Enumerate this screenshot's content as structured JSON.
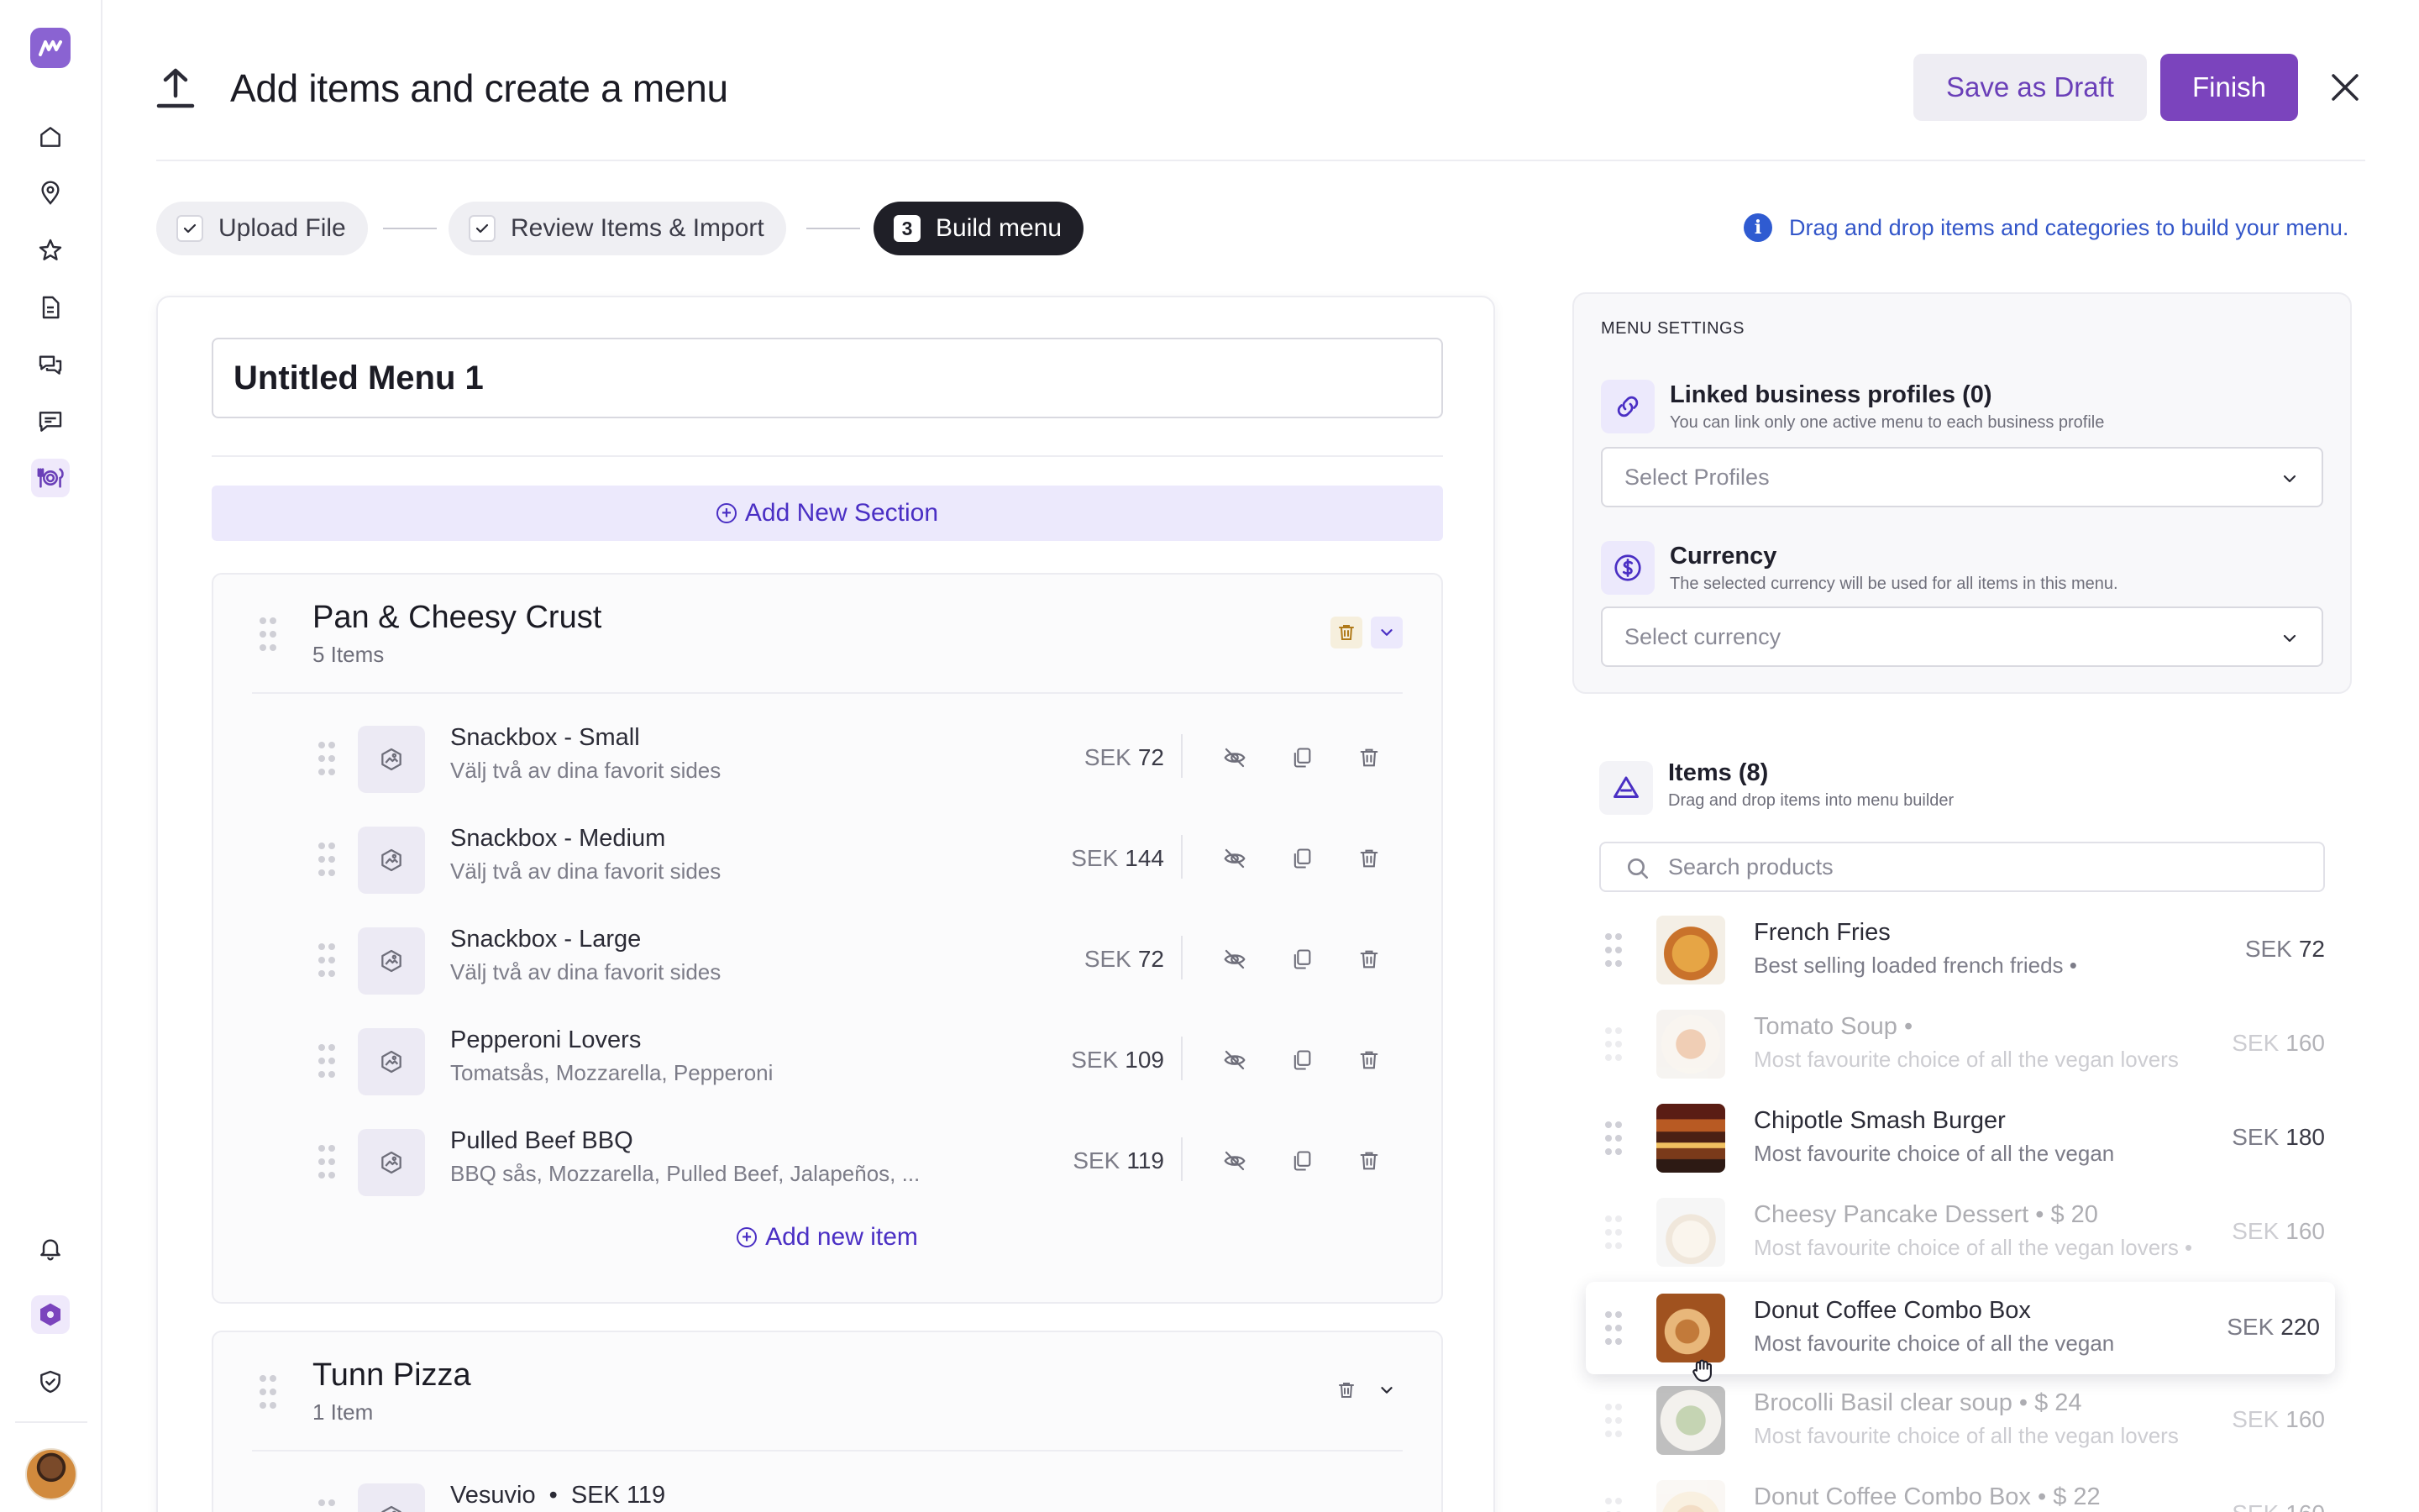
{
  "header": {
    "title": "Add items and create a menu",
    "save_draft_label": "Save as Draft",
    "finish_label": "Finish"
  },
  "stepper": {
    "steps": [
      {
        "label": "Upload File",
        "state": "done"
      },
      {
        "label": "Review Items & Import",
        "state": "done"
      },
      {
        "label": "Build menu",
        "state": "current",
        "number": "3"
      }
    ],
    "hint": "Drag and drop items and categories to build your menu."
  },
  "builder": {
    "menu_name": "Untitled Menu 1",
    "add_section_label": "Add New Section",
    "sections": [
      {
        "title": "Pan & Cheesy Crust",
        "count": "5 Items",
        "items": [
          {
            "name": "Snackbox - Small",
            "desc": "Välj två av dina favorit sides",
            "currency": "SEK",
            "price": "72"
          },
          {
            "name": "Snackbox - Medium",
            "desc": "Välj två av dina favorit sides",
            "currency": "SEK",
            "price": "144"
          },
          {
            "name": "Snackbox - Large",
            "desc": "Välj två av dina favorit sides",
            "currency": "SEK",
            "price": "72"
          },
          {
            "name": "Pepperoni Lovers",
            "desc": "Tomatsås, Mozzarella, Pepperoni",
            "currency": "SEK",
            "price": "109"
          },
          {
            "name": "Pulled Beef BBQ",
            "desc": "BBQ sås, Mozzarella, Pulled Beef, Jalapeños, ...",
            "currency": "SEK",
            "price": "119"
          }
        ],
        "add_item_label": "Add new item"
      },
      {
        "title": "Tunn Pizza",
        "count": "1 Item",
        "items": [
          {
            "name": "Vesuvio",
            "currency": "SEK",
            "price": "119",
            "separator": "•"
          }
        ]
      }
    ]
  },
  "settings": {
    "caption": "MENU SETTINGS",
    "profiles": {
      "title": "Linked business profiles (0)",
      "subtitle": "You can link only one active menu to each business profile",
      "placeholder": "Select Profiles"
    },
    "currency": {
      "title": "Currency",
      "subtitle": "The selected currency will be used for all items in this menu.",
      "placeholder": "Select currency"
    }
  },
  "items_panel": {
    "title": "Items (8)",
    "subtitle": "Drag and drop items into menu builder",
    "search_placeholder": "Search products",
    "products": [
      {
        "name": "French Fries",
        "desc": "Best selling loaded french frieds •",
        "currency": "SEK",
        "price": "72",
        "state": "normal"
      },
      {
        "name": "Tomato Soup •",
        "desc": "Most favourite choice of all the vegan lovers",
        "currency": "SEK",
        "price": "160",
        "state": "faded"
      },
      {
        "name": "Chipotle Smash Burger",
        "desc": "Most favourite choice of all the vegan",
        "currency": "SEK",
        "price": "180",
        "state": "normal"
      },
      {
        "name": "Cheesy Pancake Dessert • $ 20",
        "desc": "Most favourite choice of all the vegan lovers •",
        "currency": "SEK",
        "price": "160",
        "state": "faded"
      },
      {
        "name": "Donut Coffee Combo Box",
        "desc": "Most favourite choice of all the vegan",
        "currency": "SEK",
        "price": "220",
        "state": "dragging"
      },
      {
        "name": "Brocolli Basil clear soup • $ 24",
        "desc": "Most favourite choice of all the vegan lovers",
        "currency": "SEK",
        "price": "160",
        "state": "faded"
      },
      {
        "name": "Donut Coffee Combo Box • $ 22",
        "desc": "",
        "currency": "SEK",
        "price": "160",
        "state": "faded"
      }
    ]
  },
  "colors": {
    "accent": "#7b44bd",
    "link": "#4a2fc4",
    "info": "#2f5bd1"
  },
  "icons": [
    "logo-icon",
    "home-icon",
    "location-pin-icon",
    "star-icon",
    "document-icon",
    "chat-icon",
    "message-icon",
    "dining-icon",
    "bell-icon",
    "hexagon-icon",
    "shield-icon",
    "upload-icon",
    "close-icon",
    "check-icon",
    "info-icon",
    "grip-icon",
    "image-placeholder-icon",
    "eye-off-icon",
    "copy-icon",
    "trash-icon",
    "chevron-down-icon",
    "link-icon",
    "dollar-icon",
    "triangle-icon",
    "search-icon",
    "grab-cursor-icon"
  ]
}
